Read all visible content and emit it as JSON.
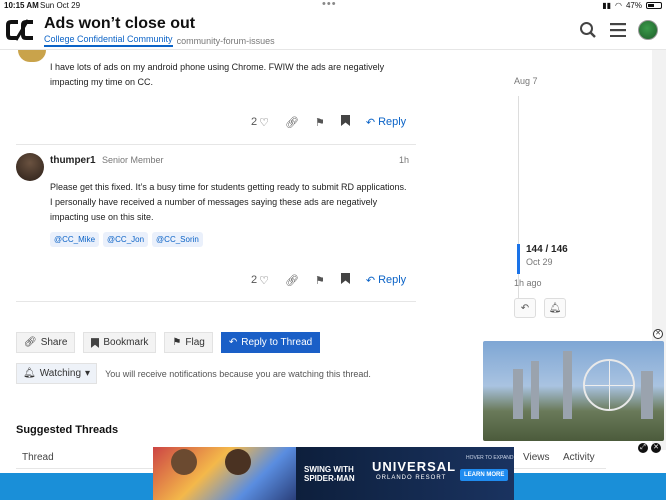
{
  "status_bar": {
    "time": "10:15 AM",
    "date": "Sun Oct 29",
    "battery": "47%"
  },
  "header": {
    "title": "Ads won’t close out",
    "category": "College Confidential Community",
    "tag": "community-forum-issues"
  },
  "posts": [
    {
      "text": "I have lots of ads on my android phone using Chrome. FWIW the ads are negatively impacting my time on CC.",
      "likes": "2",
      "reply_label": "Reply"
    },
    {
      "username": "thumper1",
      "user_title": "Senior Member",
      "time": "1h",
      "text": "Please get this fixed. It’s a busy time for students getting ready to submit RD applications. I personally have received a number of messages saying these ads are negatively impacting use on this site.",
      "mentions": [
        "@CC_Mike",
        "@CC_Jon",
        "@CC_Sorin"
      ],
      "likes": "2",
      "reply_label": "Reply"
    }
  ],
  "timeline": {
    "top_date": "Aug 7",
    "position": "144 / 146",
    "position_date": "Oct 29",
    "last_activity": "1h ago"
  },
  "footer_buttons": {
    "share": "Share",
    "bookmark": "Bookmark",
    "flag": "Flag",
    "reply_to_thread": "Reply to Thread"
  },
  "notifications": {
    "level": "Watching",
    "note": "You will receive notifications because you are watching this thread."
  },
  "suggested": {
    "title": "Suggested Threads",
    "columns": [
      "Thread",
      "Views",
      "Activity"
    ]
  },
  "ad": {
    "headline": "SWING WITH SPIDER-MAN",
    "brand": "UNIVERSAL",
    "sub": "ORLANDO RESORT",
    "hover": "HOVER TO EXPAND",
    "cta": "LEARN MORE"
  },
  "colors": {
    "accent": "#0b63c7",
    "primary_button": "#1a5fc7",
    "ad_strip": "#1a8fd8"
  }
}
